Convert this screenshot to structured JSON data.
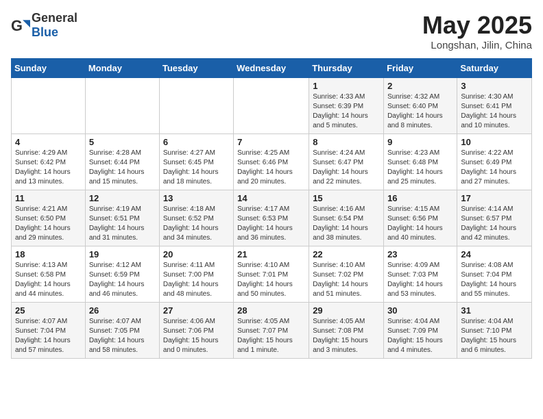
{
  "header": {
    "logo_general": "General",
    "logo_blue": "Blue",
    "month_title": "May 2025",
    "location": "Longshan, Jilin, China"
  },
  "weekdays": [
    "Sunday",
    "Monday",
    "Tuesday",
    "Wednesday",
    "Thursday",
    "Friday",
    "Saturday"
  ],
  "weeks": [
    [
      {
        "day": "",
        "info": ""
      },
      {
        "day": "",
        "info": ""
      },
      {
        "day": "",
        "info": ""
      },
      {
        "day": "",
        "info": ""
      },
      {
        "day": "1",
        "info": "Sunrise: 4:33 AM\nSunset: 6:39 PM\nDaylight: 14 hours\nand 5 minutes."
      },
      {
        "day": "2",
        "info": "Sunrise: 4:32 AM\nSunset: 6:40 PM\nDaylight: 14 hours\nand 8 minutes."
      },
      {
        "day": "3",
        "info": "Sunrise: 4:30 AM\nSunset: 6:41 PM\nDaylight: 14 hours\nand 10 minutes."
      }
    ],
    [
      {
        "day": "4",
        "info": "Sunrise: 4:29 AM\nSunset: 6:42 PM\nDaylight: 14 hours\nand 13 minutes."
      },
      {
        "day": "5",
        "info": "Sunrise: 4:28 AM\nSunset: 6:44 PM\nDaylight: 14 hours\nand 15 minutes."
      },
      {
        "day": "6",
        "info": "Sunrise: 4:27 AM\nSunset: 6:45 PM\nDaylight: 14 hours\nand 18 minutes."
      },
      {
        "day": "7",
        "info": "Sunrise: 4:25 AM\nSunset: 6:46 PM\nDaylight: 14 hours\nand 20 minutes."
      },
      {
        "day": "8",
        "info": "Sunrise: 4:24 AM\nSunset: 6:47 PM\nDaylight: 14 hours\nand 22 minutes."
      },
      {
        "day": "9",
        "info": "Sunrise: 4:23 AM\nSunset: 6:48 PM\nDaylight: 14 hours\nand 25 minutes."
      },
      {
        "day": "10",
        "info": "Sunrise: 4:22 AM\nSunset: 6:49 PM\nDaylight: 14 hours\nand 27 minutes."
      }
    ],
    [
      {
        "day": "11",
        "info": "Sunrise: 4:21 AM\nSunset: 6:50 PM\nDaylight: 14 hours\nand 29 minutes."
      },
      {
        "day": "12",
        "info": "Sunrise: 4:19 AM\nSunset: 6:51 PM\nDaylight: 14 hours\nand 31 minutes."
      },
      {
        "day": "13",
        "info": "Sunrise: 4:18 AM\nSunset: 6:52 PM\nDaylight: 14 hours\nand 34 minutes."
      },
      {
        "day": "14",
        "info": "Sunrise: 4:17 AM\nSunset: 6:53 PM\nDaylight: 14 hours\nand 36 minutes."
      },
      {
        "day": "15",
        "info": "Sunrise: 4:16 AM\nSunset: 6:54 PM\nDaylight: 14 hours\nand 38 minutes."
      },
      {
        "day": "16",
        "info": "Sunrise: 4:15 AM\nSunset: 6:56 PM\nDaylight: 14 hours\nand 40 minutes."
      },
      {
        "day": "17",
        "info": "Sunrise: 4:14 AM\nSunset: 6:57 PM\nDaylight: 14 hours\nand 42 minutes."
      }
    ],
    [
      {
        "day": "18",
        "info": "Sunrise: 4:13 AM\nSunset: 6:58 PM\nDaylight: 14 hours\nand 44 minutes."
      },
      {
        "day": "19",
        "info": "Sunrise: 4:12 AM\nSunset: 6:59 PM\nDaylight: 14 hours\nand 46 minutes."
      },
      {
        "day": "20",
        "info": "Sunrise: 4:11 AM\nSunset: 7:00 PM\nDaylight: 14 hours\nand 48 minutes."
      },
      {
        "day": "21",
        "info": "Sunrise: 4:10 AM\nSunset: 7:01 PM\nDaylight: 14 hours\nand 50 minutes."
      },
      {
        "day": "22",
        "info": "Sunrise: 4:10 AM\nSunset: 7:02 PM\nDaylight: 14 hours\nand 51 minutes."
      },
      {
        "day": "23",
        "info": "Sunrise: 4:09 AM\nSunset: 7:03 PM\nDaylight: 14 hours\nand 53 minutes."
      },
      {
        "day": "24",
        "info": "Sunrise: 4:08 AM\nSunset: 7:04 PM\nDaylight: 14 hours\nand 55 minutes."
      }
    ],
    [
      {
        "day": "25",
        "info": "Sunrise: 4:07 AM\nSunset: 7:04 PM\nDaylight: 14 hours\nand 57 minutes."
      },
      {
        "day": "26",
        "info": "Sunrise: 4:07 AM\nSunset: 7:05 PM\nDaylight: 14 hours\nand 58 minutes."
      },
      {
        "day": "27",
        "info": "Sunrise: 4:06 AM\nSunset: 7:06 PM\nDaylight: 15 hours\nand 0 minutes."
      },
      {
        "day": "28",
        "info": "Sunrise: 4:05 AM\nSunset: 7:07 PM\nDaylight: 15 hours\nand 1 minute."
      },
      {
        "day": "29",
        "info": "Sunrise: 4:05 AM\nSunset: 7:08 PM\nDaylight: 15 hours\nand 3 minutes."
      },
      {
        "day": "30",
        "info": "Sunrise: 4:04 AM\nSunset: 7:09 PM\nDaylight: 15 hours\nand 4 minutes."
      },
      {
        "day": "31",
        "info": "Sunrise: 4:04 AM\nSunset: 7:10 PM\nDaylight: 15 hours\nand 6 minutes."
      }
    ]
  ]
}
